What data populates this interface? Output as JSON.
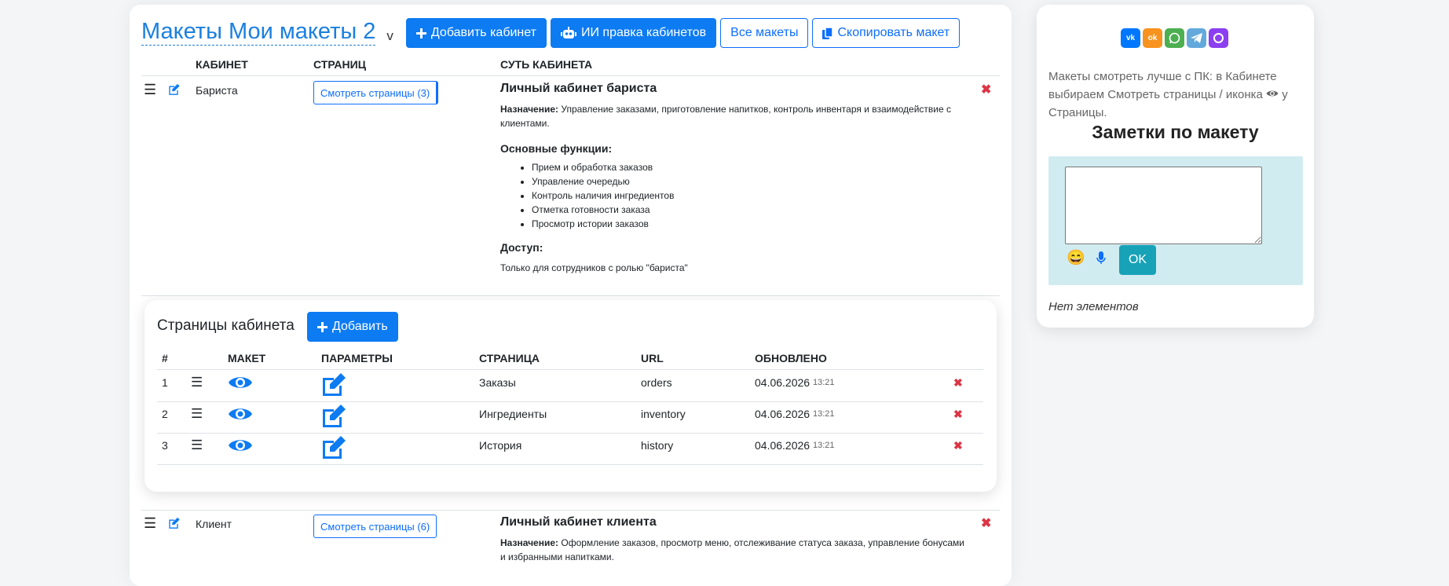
{
  "header": {
    "title": "Макеты Мои макеты 2",
    "title_suffix": "v",
    "btn_add_cabinet": "Добавить кабинет",
    "btn_ai_edit": "ИИ правка кабинетов",
    "btn_all_layouts": "Все макеты",
    "btn_copy_layout": "Скопировать макет"
  },
  "cabinets_table": {
    "col_cabinet": "КАБИНЕТ",
    "col_pages": "СТРАНИЦ",
    "col_essence": "СУТЬ КАБИНЕТА"
  },
  "cabinets": [
    {
      "name": "Бариста",
      "pages_button": "Смотреть страницы (3)",
      "title": "Личный кабинет бариста",
      "purpose_label": "Назначение:",
      "purpose": "Управление заказами, приготовление напитков, контроль инвентаря и взаимодействие с клиентами.",
      "functions_label": "Основные функции:",
      "functions": [
        "Прием и обработка заказов",
        "Управление очередью",
        "Контроль наличия ингредиентов",
        "Отметка готовности заказа",
        "Просмотр истории заказов"
      ],
      "access_label": "Доступ:",
      "access": "Только для сотрудников с ролью \"бариста\""
    },
    {
      "name": "Клиент",
      "pages_button": "Смотреть страницы (6)",
      "title": "Личный кабинет клиента",
      "purpose_label": "Назначение:",
      "purpose": "Оформление заказов, просмотр меню, отслеживание статуса заказа, управление бонусами и избранными напитками."
    }
  ],
  "pages_panel": {
    "title": "Страницы кабинета",
    "add_button": "Добавить",
    "col_num": "#",
    "col_layout": "МАКЕТ",
    "col_params": "ПАРАМЕТРЫ",
    "col_page": "СТРАНИЦА",
    "col_url": "URL",
    "col_updated": "ОБНОВЛЕНО",
    "rows": [
      {
        "num": "1",
        "page": "Заказы",
        "url": "orders",
        "date": "04.06.2026",
        "time": "13:21"
      },
      {
        "num": "2",
        "page": "Ингредиенты",
        "url": "inventory",
        "date": "04.06.2026",
        "time": "13:21"
      },
      {
        "num": "3",
        "page": "История",
        "url": "history",
        "date": "04.06.2026",
        "time": "13:21"
      }
    ]
  },
  "sidebar": {
    "social": [
      "vk",
      "ok",
      "whatsapp",
      "telegram",
      "max"
    ],
    "hint_before": "Макеты смотреть лучше с ПК: в Кабинете выбираем Смотреть страницы / иконка",
    "hint_after": "у Страницы.",
    "notes_title": "Заметки по макету",
    "ok_button": "OK",
    "empty_text": "Нет элементов"
  },
  "colors": {
    "primary": "#0d7bf2",
    "title_blue": "#1a7fe0",
    "danger": "#dc3545",
    "notes_bg": "#d1ecf1",
    "ok_btn": "#17a2b8"
  }
}
